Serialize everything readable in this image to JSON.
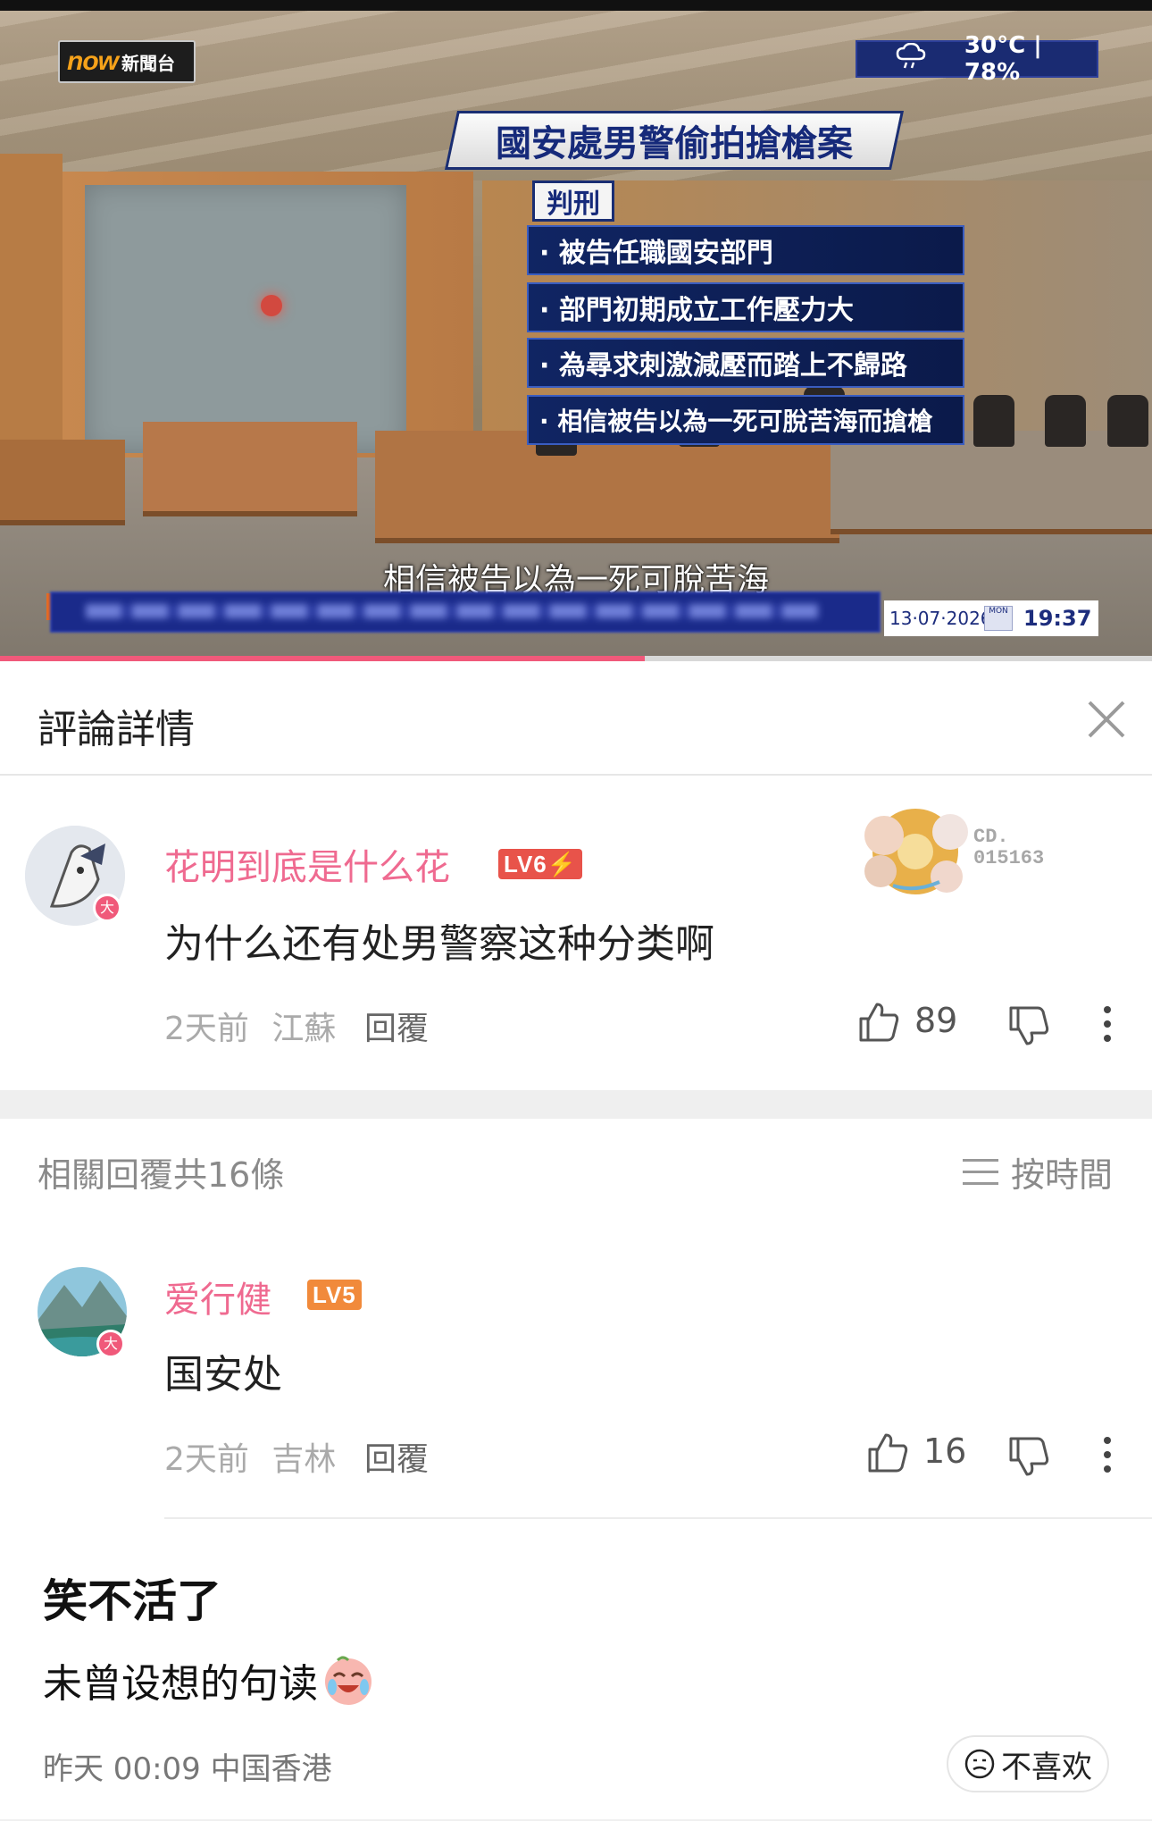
{
  "video": {
    "channel_logo_brand": "now",
    "channel_logo_name": "新聞台",
    "weather_icon": "cloud-rain-icon",
    "weather_text": "30°C | 78%",
    "headline": "國安處男警偷拍搶槍案",
    "tag": "判刑",
    "bullets": [
      "· 被告任職國安部門",
      "· 部門初期成立工作壓力大",
      "· 為尋求刺激減壓而踏上不歸路",
      "· 相信被告以為一死可脫苦海而搶槍"
    ],
    "subtitle": "相信被告以為一死可脫苦海",
    "date": "13·07·2026",
    "calendar_day": "MON",
    "time": "19:37",
    "progress": 0.56,
    "colors": {
      "progress": "#f0597a",
      "ticker": "#1a2a8a",
      "headline": "#162a7a"
    }
  },
  "panel": {
    "title": "評論詳情",
    "close_icon": "close-icon"
  },
  "main_comment": {
    "username": "花明到底是什么花",
    "level": "LV6",
    "avatar_badge": "大",
    "text": "为什么还有处男警察这种分类啊",
    "time": "2天前",
    "location": "江蘇",
    "reply_label": "回覆",
    "likes": "89",
    "decoration_code": "CD.\n015163"
  },
  "replies_header": {
    "count_text": "相關回覆共16條",
    "sort_label": "按時間"
  },
  "reply": {
    "username": "爱行健",
    "level": "LV5",
    "avatar_badge": "大",
    "text": "国安处",
    "time": "2天前",
    "location": "吉林",
    "reply_label": "回覆",
    "likes": "16"
  },
  "post": {
    "title": "笑不活了",
    "body": "未曾设想的句读",
    "emoji": "crying-laughing-emoji",
    "meta": "昨天 00:09 中国香港",
    "dislike_label": "不喜欢"
  },
  "accent": {
    "pink": "#ef6a90",
    "lv6": "#e8534a",
    "lv5": "#f18a3b"
  }
}
